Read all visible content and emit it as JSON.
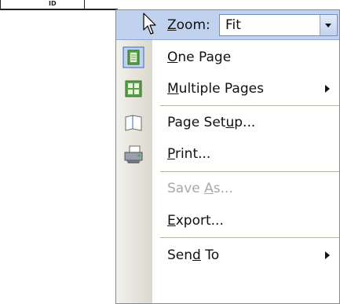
{
  "background": {
    "column_header": "ID"
  },
  "menu": {
    "zoom": {
      "label_pre": "",
      "label_accel": "Z",
      "label_post": "oom:",
      "value": "Fit"
    },
    "items": [
      {
        "pre": "",
        "accel": "O",
        "post": "ne Page",
        "icon": "one-page-icon",
        "enabled": true,
        "submenu": false
      },
      {
        "pre": "",
        "accel": "M",
        "post": "ultiple Pages",
        "icon": "multiple-pages-icon",
        "enabled": true,
        "submenu": true
      },
      {
        "pre": "Page Set",
        "accel": "u",
        "post": "p...",
        "icon": "page-setup-icon",
        "enabled": true,
        "submenu": false
      },
      {
        "pre": "",
        "accel": "P",
        "post": "rint...",
        "icon": "printer-icon",
        "enabled": true,
        "submenu": false
      },
      {
        "pre": "Save ",
        "accel": "A",
        "post": "s...",
        "icon": "",
        "enabled": false,
        "submenu": false
      },
      {
        "pre": "",
        "accel": "E",
        "post": "xport...",
        "icon": "",
        "enabled": true,
        "submenu": false
      },
      {
        "pre": "Sen",
        "accel": "d",
        "post": " To",
        "icon": "",
        "enabled": true,
        "submenu": true
      }
    ]
  }
}
